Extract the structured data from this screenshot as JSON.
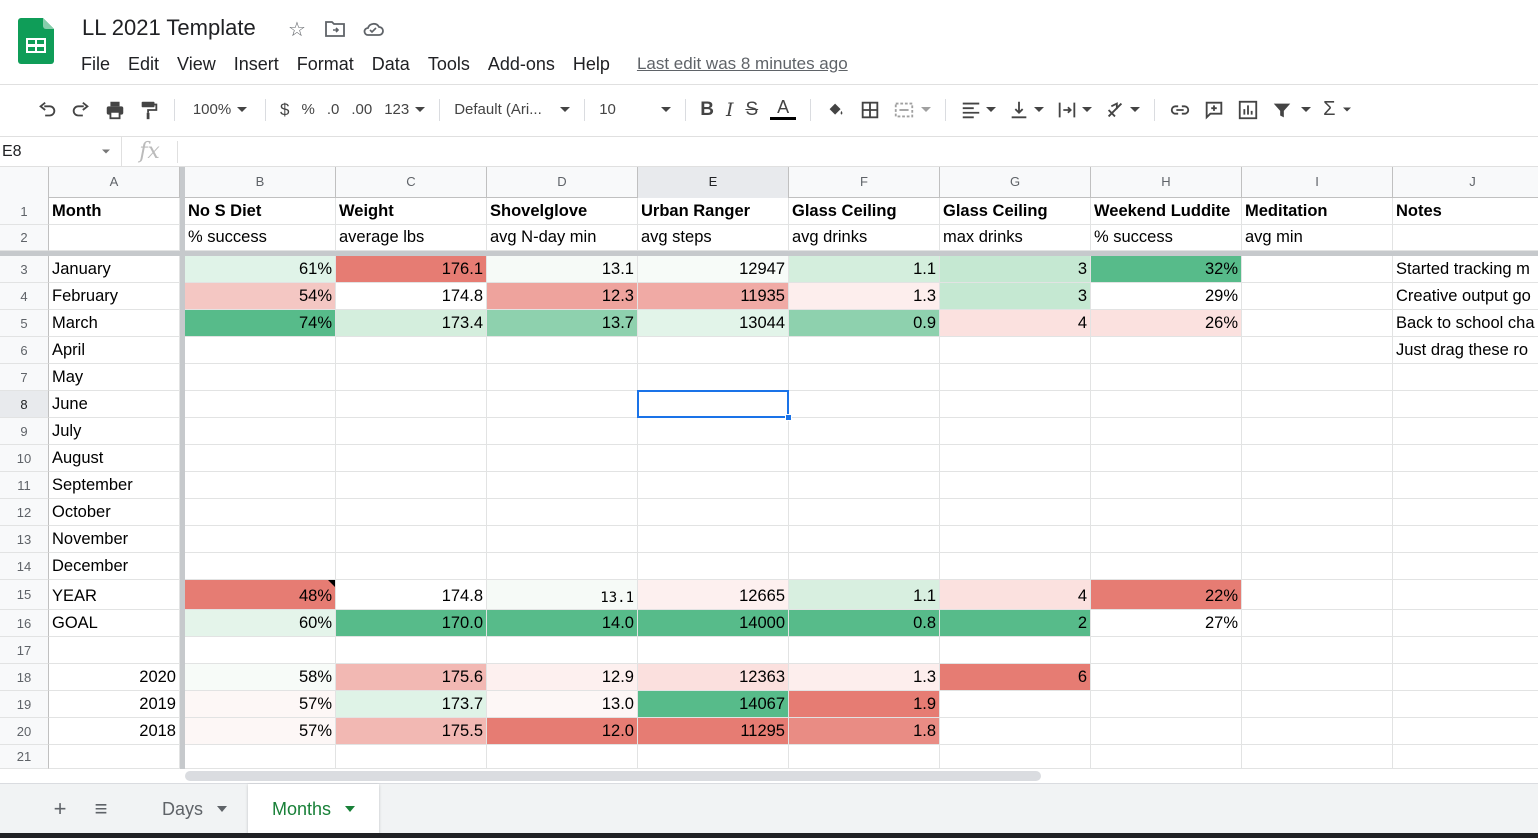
{
  "header": {
    "title": "LL 2021 Template",
    "menu": [
      "File",
      "Edit",
      "View",
      "Insert",
      "Format",
      "Data",
      "Tools",
      "Add-ons",
      "Help"
    ],
    "last_edit": "Last edit was 8 minutes ago",
    "icons": [
      "star-icon",
      "move-to-folder-icon",
      "cloud-status-icon"
    ]
  },
  "toolbar": {
    "zoom": "100%",
    "currency": "$",
    "percent": "%",
    "decrease_decimal": ".0",
    "increase_decimal": ".00",
    "more_formats": "123",
    "font": "Default (Ari...",
    "font_size": "10",
    "bold": "B",
    "italic": "I",
    "strikethrough": "S",
    "text_color": "A",
    "sum": "Σ"
  },
  "formula_bar": {
    "name_box": "E8",
    "fx": "fx",
    "value": ""
  },
  "grid": {
    "columns": [
      "A",
      "B",
      "C",
      "D",
      "E",
      "F",
      "G",
      "H",
      "I",
      "J"
    ],
    "row_numbers": [
      "1",
      "2",
      "3",
      "4",
      "5",
      "6",
      "7",
      "8",
      "9",
      "10",
      "11",
      "12",
      "13",
      "14",
      "15",
      "16",
      "17",
      "18",
      "19",
      "20",
      "21"
    ],
    "header_row": [
      "Month",
      "No S Diet",
      "Weight",
      "Shovelglove",
      "Urban Ranger",
      "Glass Ceiling",
      "Glass Ceiling",
      "Weekend Luddite",
      "Meditation",
      "Notes"
    ],
    "subheader_row": [
      "",
      "% success",
      "average lbs",
      "avg N-day min",
      "avg steps",
      "avg drinks",
      "max drinks",
      "% success",
      "avg min",
      ""
    ],
    "rows": [
      {
        "cells": [
          "January",
          "61%",
          "176.1",
          "13.1",
          "12947",
          "1.1",
          "3",
          "32%",
          "",
          "Started tracking m"
        ]
      },
      {
        "cells": [
          "February",
          "54%",
          "174.8",
          "12.3",
          "11935",
          "1.3",
          "3",
          "29%",
          "",
          "Creative output go"
        ]
      },
      {
        "cells": [
          "March",
          "74%",
          "173.4",
          "13.7",
          "13044",
          "0.9",
          "4",
          "26%",
          "",
          "Back to school cha"
        ]
      },
      {
        "cells": [
          "April",
          "",
          "",
          "",
          "",
          "",
          "",
          "",
          "",
          "Just drag these ro"
        ]
      },
      {
        "cells": [
          "May",
          "",
          "",
          "",
          "",
          "",
          "",
          "",
          "",
          ""
        ]
      },
      {
        "cells": [
          "June",
          "",
          "",
          "",
          "",
          "",
          "",
          "",
          "",
          ""
        ]
      },
      {
        "cells": [
          "July",
          "",
          "",
          "",
          "",
          "",
          "",
          "",
          "",
          ""
        ]
      },
      {
        "cells": [
          "August",
          "",
          "",
          "",
          "",
          "",
          "",
          "",
          "",
          ""
        ]
      },
      {
        "cells": [
          "September",
          "",
          "",
          "",
          "",
          "",
          "",
          "",
          "",
          ""
        ]
      },
      {
        "cells": [
          "October",
          "",
          "",
          "",
          "",
          "",
          "",
          "",
          "",
          ""
        ]
      },
      {
        "cells": [
          "November",
          "",
          "",
          "",
          "",
          "",
          "",
          "",
          "",
          ""
        ]
      },
      {
        "cells": [
          "December",
          "",
          "",
          "",
          "",
          "",
          "",
          "",
          "",
          ""
        ]
      },
      {
        "cells": [
          "YEAR",
          "48%",
          "174.8",
          "13.1",
          "12665",
          "1.1",
          "4",
          "22%",
          "",
          ""
        ]
      },
      {
        "cells": [
          "GOAL",
          "60%",
          "170.0",
          "14.0",
          "14000",
          "0.8",
          "2",
          "27%",
          "",
          ""
        ]
      },
      {
        "cells": [
          "",
          "",
          "",
          "",
          "",
          "",
          "",
          "",
          "",
          ""
        ]
      },
      {
        "cells": [
          "2020",
          "58%",
          "175.6",
          "12.9",
          "12363",
          "1.3",
          "6",
          "",
          "",
          ""
        ]
      },
      {
        "cells": [
          "2019",
          "57%",
          "173.7",
          "13.0",
          "14067",
          "1.9",
          "",
          "",
          "",
          ""
        ]
      },
      {
        "cells": [
          "2018",
          "57%",
          "175.5",
          "12.0",
          "11295",
          "1.8",
          "",
          "",
          "",
          ""
        ]
      },
      {
        "cells": [
          "",
          "",
          "",
          "",
          "",
          "",
          "",
          "",
          "",
          ""
        ]
      }
    ],
    "cell_colors": {
      "3": [
        "",
        "#e0f3e8",
        "#e67c73",
        "#f6faf7",
        "#f7fbf8",
        "#d4eedd",
        "#c5e8d2",
        "#57bb8a",
        "",
        ""
      ],
      "4": [
        "",
        "#f4c7c3",
        "",
        "#eea39d",
        "#f0aaa5",
        "#fdeeed",
        "#c5e8d2",
        "",
        "",
        ""
      ],
      "5": [
        "",
        "#57bb8a",
        "#d4eedd",
        "#8ed1ae",
        "#e2f4e9",
        "#8ed1ae",
        "#fbe1df",
        "#fbe1df",
        "",
        ""
      ],
      "15": [
        "",
        "#e67c73",
        "",
        "#f6faf7",
        "#fdf0ef",
        "#d8efe0",
        "#fbe1df",
        "#e67c73",
        "",
        ""
      ],
      "16": [
        "",
        "#e4f4ea",
        "#57bb8a",
        "#57bb8a",
        "#57bb8a",
        "#57bb8a",
        "#57bb8a",
        "",
        "",
        ""
      ],
      "18": [
        "",
        "#f7fbf8",
        "#f2b8b3",
        "#fdf0ef",
        "#fbe0de",
        "#fdeeed",
        "#e67c73",
        "",
        "",
        ""
      ],
      "19": [
        "",
        "#fdf7f6",
        "#dff3e7",
        "#fdf7f6",
        "#57bb8a",
        "#e67c73",
        "",
        "",
        "",
        ""
      ],
      "20": [
        "",
        "#fdf7f6",
        "#f2b8b3",
        "#e67c73",
        "#e67c73",
        "#e98c84",
        "",
        "",
        "",
        ""
      ]
    },
    "selected_cell": "E8"
  },
  "sheets": {
    "add": "+",
    "list": "≡",
    "tabs": [
      {
        "label": "Days",
        "active": false
      },
      {
        "label": "Months",
        "active": true
      }
    ]
  },
  "colors": {
    "accent": "#1a73e8",
    "sheets_green": "#188038",
    "logo_green": "#0f9d58"
  }
}
